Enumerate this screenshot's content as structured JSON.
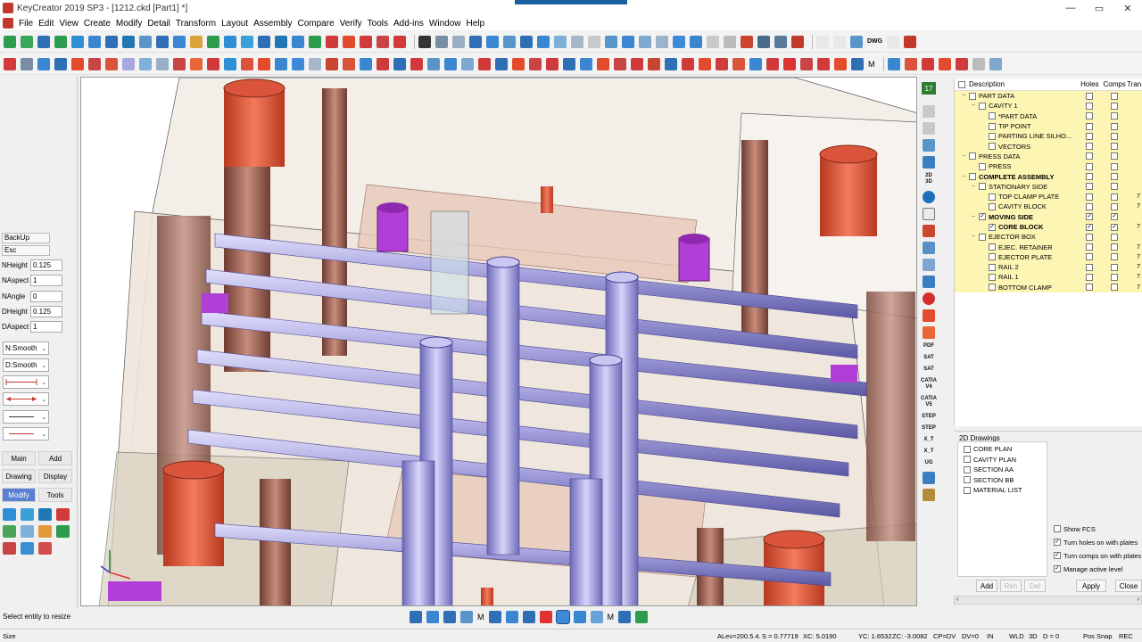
{
  "window": {
    "title": "KeyCreator 2019 SP3 - [1212.ckd [Part1] *]",
    "controls": [
      "—",
      "▭",
      "✕"
    ]
  },
  "menu": [
    "File",
    "Edit",
    "View",
    "Create",
    "Modify",
    "Detail",
    "Transform",
    "Layout",
    "Assembly",
    "Compare",
    "Verify",
    "Tools",
    "Add-ins",
    "Window",
    "Help"
  ],
  "toolbar_text": {
    "dwg_label": "DWG",
    "m_label": "M"
  },
  "left_panel": {
    "backup": "BackUp",
    "esc": "Esc",
    "fields": [
      {
        "label": "NHeight",
        "value": "0.125"
      },
      {
        "label": "NAspect",
        "value": "1"
      },
      {
        "label": "NAngle",
        "value": "0"
      },
      {
        "label": "DHeight",
        "value": "0.125"
      },
      {
        "label": "DAspect",
        "value": "1"
      }
    ],
    "selects": [
      "N:Smooth",
      "D:Smooth"
    ],
    "buttons": [
      "Main",
      "Add",
      "Drawing",
      "Display",
      "Modify",
      "Tools"
    ],
    "active_button": "Modify"
  },
  "vtoolbar": {
    "layer": "17",
    "labels": [
      "2D\n3D",
      "PDF",
      "SAT",
      "SAT",
      "CATIA\nV4",
      "CATIA\nV5",
      "STEP",
      "STEP",
      "X_T",
      "X_T",
      "UG"
    ]
  },
  "tree": {
    "columns": {
      "description": "Description",
      "holes": "Holes",
      "comps": "Comps",
      "tr": "Tran"
    },
    "rows": [
      {
        "label": "PART DATA",
        "indent": 0,
        "exp": "−",
        "bold": false,
        "holes": false,
        "comps": false,
        "count": ""
      },
      {
        "label": "CAVITY 1",
        "indent": 1,
        "exp": "−",
        "bold": false,
        "holes": false,
        "comps": false,
        "count": ""
      },
      {
        "label": "*PART DATA",
        "indent": 2,
        "exp": "",
        "bold": false,
        "holes": false,
        "comps": false,
        "count": ""
      },
      {
        "label": "TIP POINT",
        "indent": 2,
        "exp": "",
        "bold": false,
        "holes": false,
        "comps": false,
        "count": ""
      },
      {
        "label": "PARTING LINE SILHO...",
        "indent": 2,
        "exp": "",
        "bold": false,
        "holes": false,
        "comps": false,
        "count": ""
      },
      {
        "label": "VECTORS",
        "indent": 2,
        "exp": "",
        "bold": false,
        "holes": false,
        "comps": false,
        "count": ""
      },
      {
        "label": "PRESS DATA",
        "indent": 0,
        "exp": "−",
        "bold": false,
        "holes": false,
        "comps": false,
        "count": ""
      },
      {
        "label": "PRESS",
        "indent": 1,
        "exp": "",
        "bold": false,
        "holes": false,
        "comps": false,
        "count": ""
      },
      {
        "label": "COMPLETE ASSEMBLY",
        "indent": 0,
        "exp": "−",
        "bold": true,
        "holes": false,
        "comps": false,
        "count": ""
      },
      {
        "label": "STATIONARY SIDE",
        "indent": 1,
        "exp": "−",
        "bold": false,
        "holes": false,
        "comps": false,
        "count": ""
      },
      {
        "label": "TOP CLAMP PLATE",
        "indent": 2,
        "exp": "",
        "bold": false,
        "holes": false,
        "comps": false,
        "count": "7"
      },
      {
        "label": "CAVITY BLOCK",
        "indent": 2,
        "exp": "",
        "bold": false,
        "holes": false,
        "comps": false,
        "count": "7"
      },
      {
        "label": "MOVING SIDE",
        "indent": 1,
        "exp": "−",
        "bold": true,
        "checked": true,
        "holes": true,
        "comps": true,
        "count": ""
      },
      {
        "label": "CORE BLOCK",
        "indent": 2,
        "exp": "",
        "bold": true,
        "checked": true,
        "holes": true,
        "comps": true,
        "count": "7"
      },
      {
        "label": "EJECTOR BOX",
        "indent": 1,
        "exp": "−",
        "bold": false,
        "holes": false,
        "comps": false,
        "count": ""
      },
      {
        "label": "EJEC. RETAINER",
        "indent": 2,
        "exp": "",
        "bold": false,
        "holes": false,
        "comps": false,
        "count": "7"
      },
      {
        "label": "EJECTOR PLATE",
        "indent": 2,
        "exp": "",
        "bold": false,
        "holes": false,
        "comps": false,
        "count": "7"
      },
      {
        "label": "RAIL 2",
        "indent": 2,
        "exp": "",
        "bold": false,
        "holes": false,
        "comps": false,
        "count": "7"
      },
      {
        "label": "RAIL 1",
        "indent": 2,
        "exp": "",
        "bold": false,
        "holes": false,
        "comps": false,
        "count": "7"
      },
      {
        "label": "BOTTOM CLAMP",
        "indent": 2,
        "exp": "",
        "bold": false,
        "holes": false,
        "comps": false,
        "count": "7"
      }
    ]
  },
  "drawings": {
    "legend": "2D Drawings",
    "items": [
      "CORE PLAN",
      "CAVITY PLAN",
      "SECTION AA",
      "SECTION BB",
      "MATERIAL LIST"
    ],
    "options": [
      {
        "label": "Show FCS",
        "checked": false
      },
      {
        "label": "Turn holes on with plates",
        "checked": true
      },
      {
        "label": "Turn comps on with plates",
        "checked": true
      },
      {
        "label": "Manage active level",
        "checked": true
      }
    ],
    "buttons": {
      "add": "Add",
      "rename": "Ren",
      "delete": "Del",
      "apply": "Apply",
      "close": "Close"
    }
  },
  "prompt": "Select entity to resize",
  "status": {
    "size": "Size",
    "alev": "ALev=200.5.4.",
    "scale": "S = 0.77719",
    "xc": "XC: 5.0190",
    "yc": "YC: 1.6532",
    "zc": "ZC: -3.0082",
    "cpdv": "CP=DV",
    "dv": "DV=0",
    "in": "IN",
    "wld": "WLD",
    "d3": "3D",
    "d": "D = 0",
    "possnap": "Pos Snap",
    "rec": "REC"
  },
  "colors": {
    "highlight_row": "#fcf5b3",
    "active_button": "#5b7fd1",
    "pin_red": "#e8684f",
    "pin_purple": "#a9a6e0",
    "ejector_magenta": "#b23ed8",
    "plate_brown": "#9b6b5c"
  }
}
